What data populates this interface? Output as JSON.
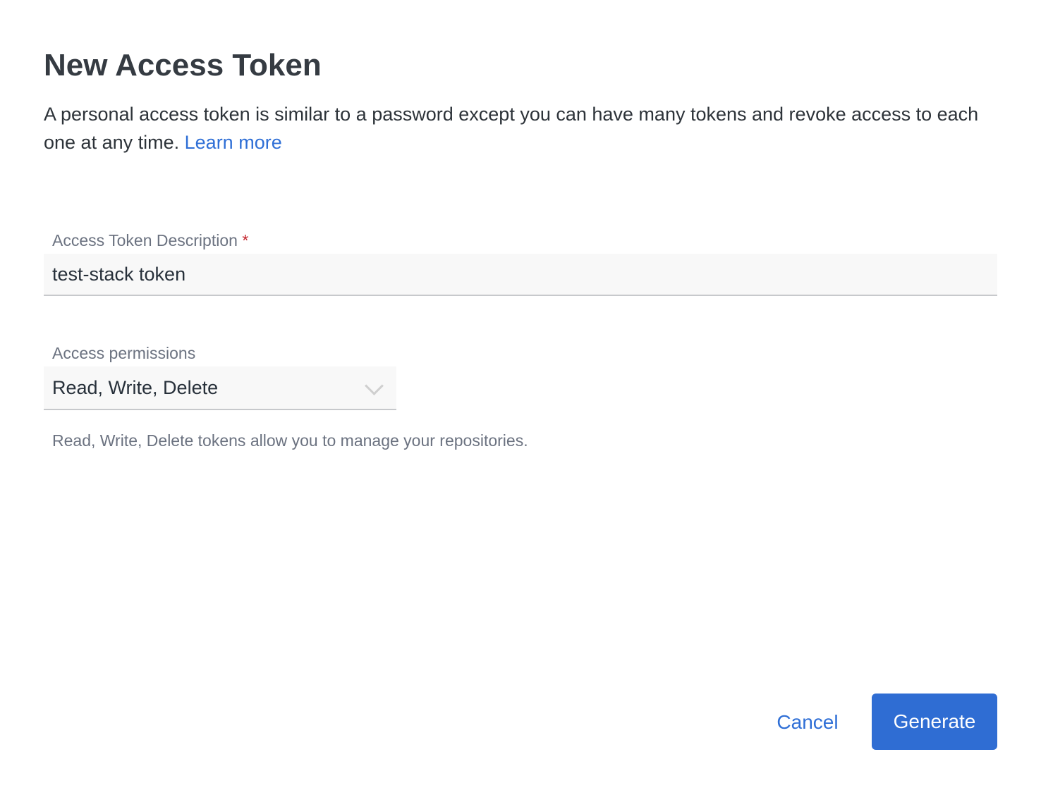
{
  "dialog": {
    "title": "New Access Token",
    "description": "A personal access token is similar to a password except you can have many tokens and revoke access to each one at any time.",
    "learn_more": "Learn more"
  },
  "description_field": {
    "label": "Access Token Description",
    "required_mark": "*",
    "value": "test-stack token"
  },
  "permissions_field": {
    "label": "Access permissions",
    "value": "Read, Write, Delete",
    "help": "Read, Write, Delete tokens allow you to manage your repositories."
  },
  "actions": {
    "cancel": "Cancel",
    "generate": "Generate"
  },
  "colors": {
    "accent": "#2f6dd3",
    "required": "#c4262e"
  }
}
